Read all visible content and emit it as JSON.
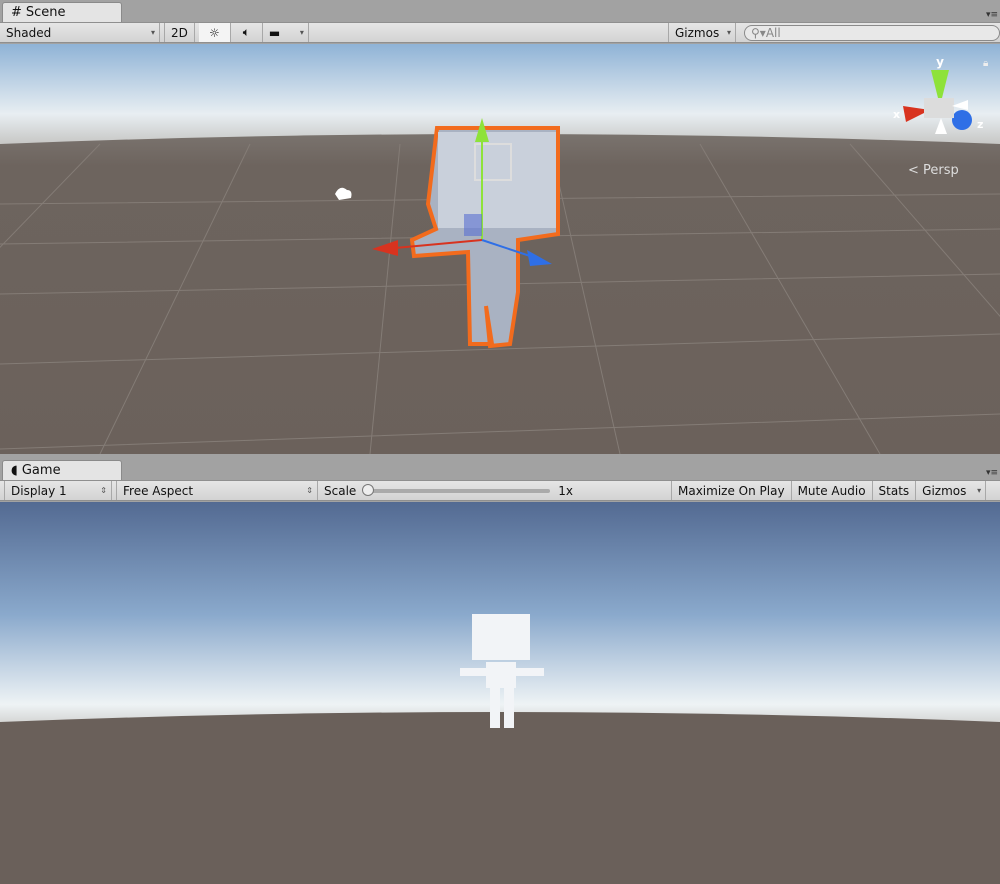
{
  "scene": {
    "tab_label": "Scene",
    "tab_icon": "grid-hash-icon",
    "draw_mode": "Shaded",
    "btn_2d": "2D",
    "gizmos_label": "Gizmos",
    "search_placeholder": "All",
    "projection_label": "Persp",
    "axes": {
      "x": "x",
      "y": "y",
      "z": "z"
    },
    "colors": {
      "selection_outline": "#f26b1d",
      "x_axis": "#d8331f",
      "y_axis": "#8ee23a",
      "z_axis": "#2f6fe6"
    }
  },
  "game": {
    "tab_label": "Game",
    "tab_icon": "pacman-icon",
    "display": "Display 1",
    "aspect": "Free Aspect",
    "scale_label": "Scale",
    "scale_value": "1x",
    "scale_slider": 0,
    "maximize": "Maximize On Play",
    "mute": "Mute Audio",
    "stats": "Stats",
    "gizmos": "Gizmos"
  }
}
